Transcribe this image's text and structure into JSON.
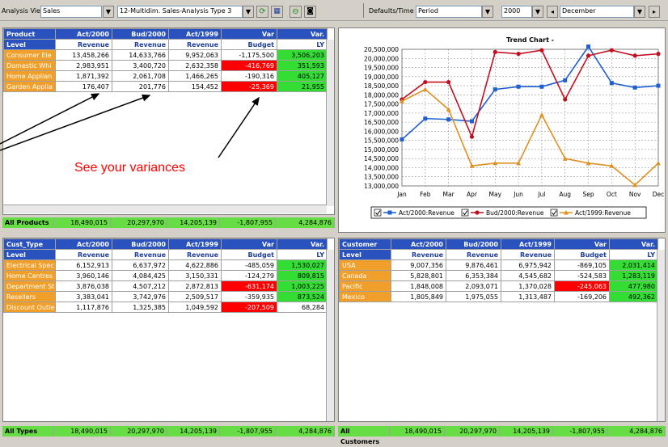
{
  "toolbar": {
    "analysis_view_label": "Analysis View",
    "analysis_view_value": "Sales",
    "report_value": "12-Multidim. Sales-Analysis Type 3",
    "defaults_time_label": "Defaults/Time",
    "period_value": "Period",
    "year_value": "2000",
    "month_value": "December"
  },
  "product_grid": {
    "headers": [
      "Product",
      "Act/2000",
      "Bud/2000",
      "Act/1999",
      "Var",
      "Var."
    ],
    "subheaders": [
      "Level",
      "Revenue",
      "Revenue",
      "Revenue",
      "Budget",
      "LY"
    ],
    "rows": [
      {
        "label": "Consumer Ele",
        "v": [
          "13,458,266",
          "14,633,766",
          "9,952,063",
          "-1,175,500",
          "3,506,203"
        ]
      },
      {
        "label": "Domestic Whi",
        "v": [
          "2,983,951",
          "3,400,720",
          "2,632,358",
          "-416,769",
          "351,593"
        ]
      },
      {
        "label": "Home Applian",
        "v": [
          "1,871,392",
          "2,061,708",
          "1,466,265",
          "-190,316",
          "405,127"
        ]
      },
      {
        "label": "Garden Applia",
        "v": [
          "176,407",
          "201,776",
          "154,452",
          "-25,369",
          "21,955"
        ]
      }
    ],
    "total": {
      "label": "All Products",
      "v": [
        "18,490,015",
        "20,297,970",
        "14,205,139",
        "-1,807,955",
        "4,284,876"
      ]
    }
  },
  "cust_type_grid": {
    "headers": [
      "Cust_Type",
      "Act/2000",
      "Bud/2000",
      "Act/1999",
      "Var",
      "Var."
    ],
    "subheaders": [
      "Level",
      "Revenue",
      "Revenue",
      "Revenue",
      "Budget",
      "LY"
    ],
    "rows": [
      {
        "label": "Electrical Spec",
        "v": [
          "6,152,913",
          "6,637,972",
          "4,622,886",
          "-485,059",
          "1,530,027"
        ]
      },
      {
        "label": "Home Centres",
        "v": [
          "3,960,146",
          "4,084,425",
          "3,150,331",
          "-124,279",
          "809,815"
        ]
      },
      {
        "label": "Department St",
        "v": [
          "3,876,038",
          "4,507,212",
          "2,872,813",
          "-631,174",
          "1,003,225"
        ]
      },
      {
        "label": "Resellers",
        "v": [
          "3,383,041",
          "3,742,976",
          "2,509,517",
          "-359,935",
          "873,524"
        ]
      },
      {
        "label": "Discount Outle",
        "v": [
          "1,117,876",
          "1,325,385",
          "1,049,592",
          "-207,509",
          "68,284"
        ]
      }
    ],
    "total": {
      "label": "All Types",
      "v": [
        "18,490,015",
        "20,297,970",
        "14,205,139",
        "-1,807,955",
        "4,284,876"
      ]
    }
  },
  "customer_grid": {
    "headers": [
      "Customer",
      "Act/2000",
      "Bud/2000",
      "Act/1999",
      "Var",
      "Var."
    ],
    "subheaders": [
      "Level",
      "Revenue",
      "Revenue",
      "Revenue",
      "Budget",
      "LY"
    ],
    "rows": [
      {
        "label": "USA",
        "v": [
          "9,007,356",
          "9,876,461",
          "6,975,942",
          "-869,105",
          "2,031,414"
        ]
      },
      {
        "label": "Canada",
        "v": [
          "5,828,801",
          "6,353,384",
          "4,545,682",
          "-524,583",
          "1,283,119"
        ]
      },
      {
        "label": "Pacific",
        "v": [
          "1,848,008",
          "2,093,071",
          "1,370,028",
          "-245,063",
          "477,980"
        ]
      },
      {
        "label": "Mexico",
        "v": [
          "1,805,849",
          "1,975,055",
          "1,313,487",
          "-169,206",
          "492,362"
        ]
      }
    ],
    "total": {
      "label": "All Customers",
      "v": [
        "18,490,015",
        "20,297,970",
        "14,205,139",
        "-1,807,955",
        "4,284,876"
      ]
    }
  },
  "annotation": "See your variances",
  "colors": {
    "header": "#2a52be",
    "row_label": "#f0a02a",
    "negative": "#ff0000",
    "positive": "#33dd33"
  },
  "chart_data": {
    "type": "line",
    "title": "Trend Chart -",
    "categories": [
      "Jan",
      "Feb",
      "Mar",
      "Apr",
      "May",
      "Jun",
      "Jul",
      "Aug",
      "Sep",
      "Oct",
      "Nov",
      "Dec"
    ],
    "ylim": [
      13000000,
      20500000
    ],
    "yticks": [
      "20,500,000",
      "20,000,000",
      "19,500,000",
      "19,000,000",
      "18,500,000",
      "18,000,000",
      "17,500,000",
      "17,000,000",
      "16,500,000",
      "16,000,000",
      "15,500,000",
      "15,000,000",
      "14,500,000",
      "14,000,000",
      "13,500,000",
      "13,000,000"
    ],
    "grid": true,
    "legend_position": "bottom",
    "series": [
      {
        "name": "Act/2000:Revenue",
        "color": "#1f5fd0",
        "values": [
          15550000,
          16700000,
          16650000,
          16550000,
          18300000,
          18450000,
          18450000,
          18800000,
          20650000,
          18650000,
          18400000,
          18500000
        ]
      },
      {
        "name": "Bud/2000:Revenue",
        "color": "#c01020",
        "values": [
          17750000,
          18700000,
          18700000,
          15700000,
          20350000,
          20250000,
          20450000,
          17750000,
          20150000,
          20450000,
          20150000,
          20250000
        ]
      },
      {
        "name": "Act/1999:Revenue",
        "color": "#e09020",
        "values": [
          17650000,
          18300000,
          17200000,
          14100000,
          14250000,
          14250000,
          16900000,
          14500000,
          14250000,
          14100000,
          13050000,
          14250000
        ]
      }
    ]
  }
}
